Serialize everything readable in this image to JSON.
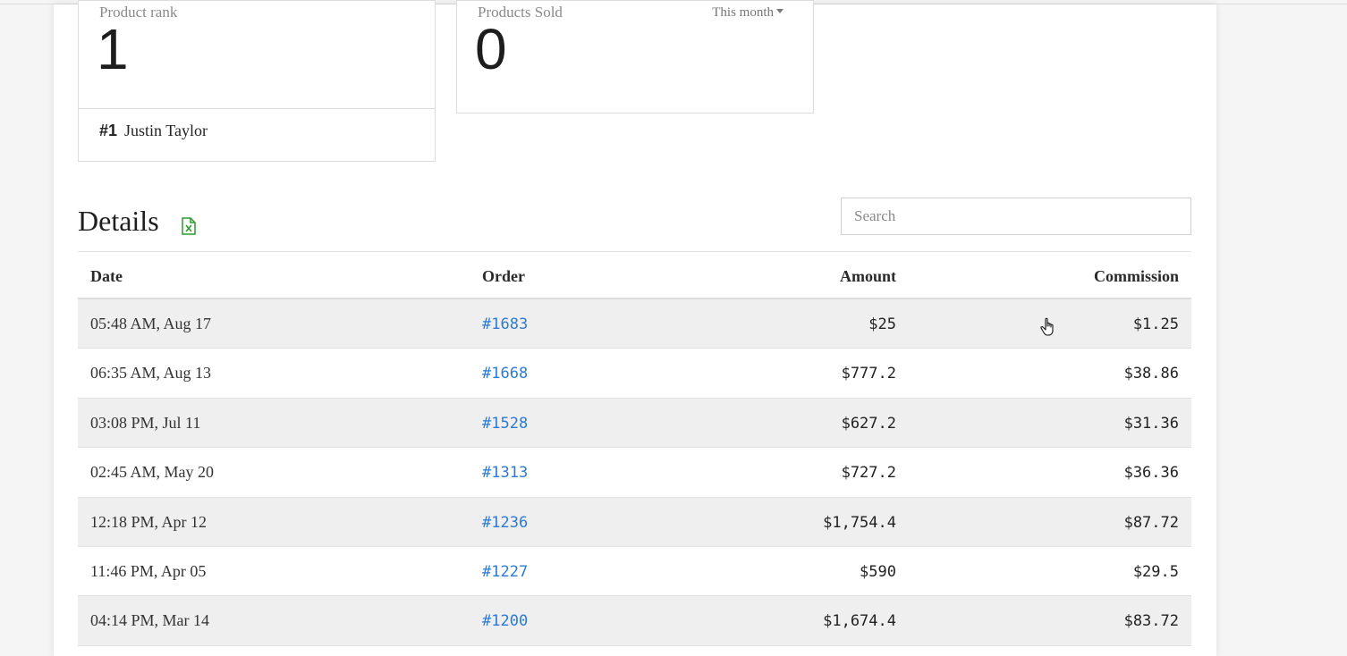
{
  "stats": {
    "rank": {
      "label": "Product rank",
      "value": "1",
      "leader_position": "#1",
      "leader_name": "Justin Taylor"
    },
    "sold": {
      "label": "Products Sold",
      "value": "0",
      "period": "This month"
    }
  },
  "details": {
    "title": "Details",
    "export_icon": "excel-export-icon",
    "search_placeholder": "Search",
    "columns": [
      "Date",
      "Order",
      "Amount",
      "Commission"
    ],
    "rows": [
      {
        "date": "05:48 AM, Aug 17",
        "order": "#1683",
        "amount": "$25",
        "commission": "$1.25"
      },
      {
        "date": "06:35 AM, Aug 13",
        "order": "#1668",
        "amount": "$777.2",
        "commission": "$38.86"
      },
      {
        "date": "03:08 PM, Jul 11",
        "order": "#1528",
        "amount": "$627.2",
        "commission": "$31.36"
      },
      {
        "date": "02:45 AM, May 20",
        "order": "#1313",
        "amount": "$727.2",
        "commission": "$36.36"
      },
      {
        "date": "12:18 PM, Apr 12",
        "order": "#1236",
        "amount": "$1,754.4",
        "commission": "$87.72"
      },
      {
        "date": "11:46 PM, Apr 05",
        "order": "#1227",
        "amount": "$590",
        "commission": "$29.5"
      },
      {
        "date": "04:14 PM, Mar 14",
        "order": "#1200",
        "amount": "$1,674.4",
        "commission": "$83.72"
      }
    ]
  },
  "colors": {
    "link": "#2b7bd6",
    "excel_green": "#2e9b2e",
    "stripe": "#efefef"
  }
}
